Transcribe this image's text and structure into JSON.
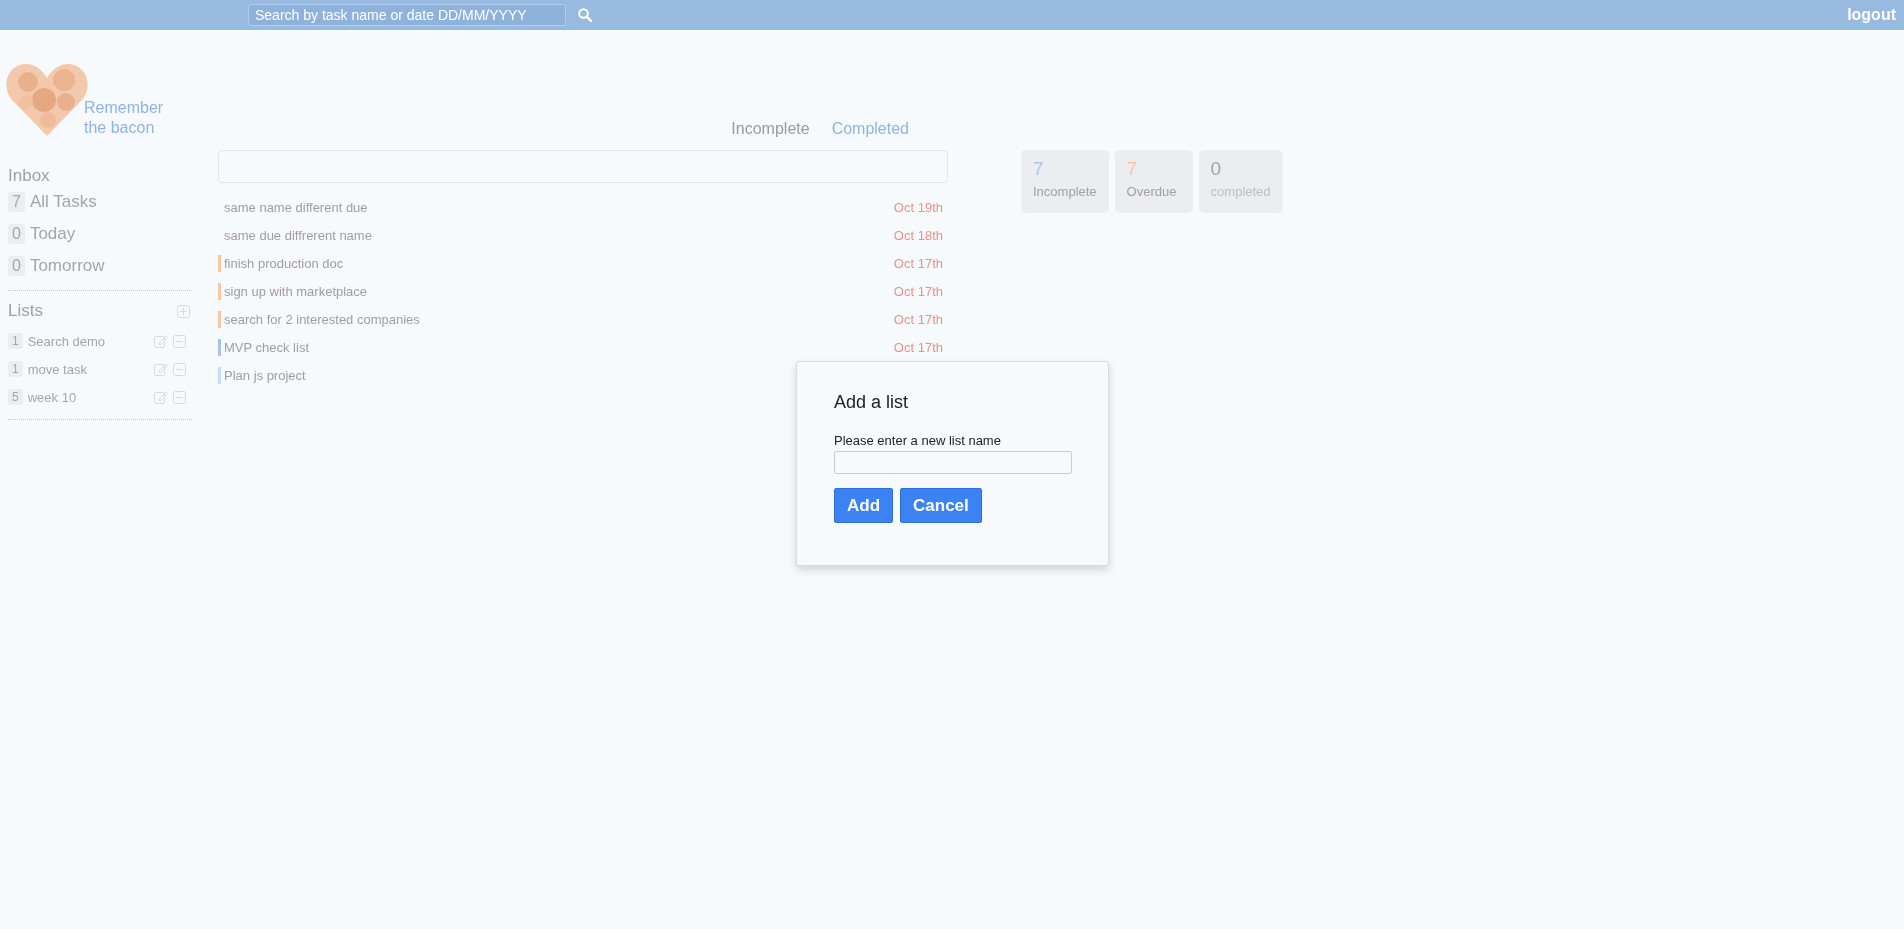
{
  "top_bar": {
    "search": {
      "placeholder": "Search by task name or date DD/MM/YYYY"
    },
    "logout": "logout"
  },
  "logo": {
    "title_line_1": "Remember",
    "title_line_2": "the bacon"
  },
  "sidebar": {
    "inbox_heading": "Inbox",
    "inbox_items": [
      {
        "count": "7",
        "label": "All Tasks"
      },
      {
        "count": "0",
        "label": "Today"
      },
      {
        "count": "0",
        "label": "Tomorrow"
      }
    ],
    "lists_heading": "Lists",
    "lists": [
      {
        "count": "1",
        "name": "Search demo"
      },
      {
        "count": "1",
        "name": "move task"
      },
      {
        "count": "5",
        "name": "week 10"
      }
    ]
  },
  "tabs": [
    {
      "label": "Incomplete",
      "selected": true
    },
    {
      "label": "Completed",
      "selected": false
    }
  ],
  "tasks": [
    {
      "name": "same name different due",
      "due": "Oct 19th"
    },
    {
      "name": "same due diffrerent name",
      "due": "Oct 18th"
    },
    {
      "name": "finish production doc",
      "due": "Oct 17th",
      "color": "#f5c6a3"
    },
    {
      "name": "sign up with marketplace",
      "due": "Oct 17th",
      "color": "#f5c6a3"
    },
    {
      "name": "search for 2 interested companies",
      "due": "Oct 17th",
      "color": "#f5c6a3"
    },
    {
      "name": "MVP check list",
      "due": "Oct 17th",
      "color": "#a9c3e3"
    },
    {
      "name": "Plan js project",
      "color": "#c6ddf3"
    }
  ],
  "stats": [
    {
      "value": "7",
      "label": "Incomplete",
      "color": "#a9c6ea"
    },
    {
      "value": "7",
      "label": "Overdue",
      "color": "#f5c4a6"
    },
    {
      "value": "0",
      "label": "completed",
      "color": "#9ea5ae"
    }
  ],
  "dialog": {
    "title": "Add a list",
    "label": "Please enter a new list name",
    "buttons": [
      "Add",
      "Cancel"
    ]
  }
}
